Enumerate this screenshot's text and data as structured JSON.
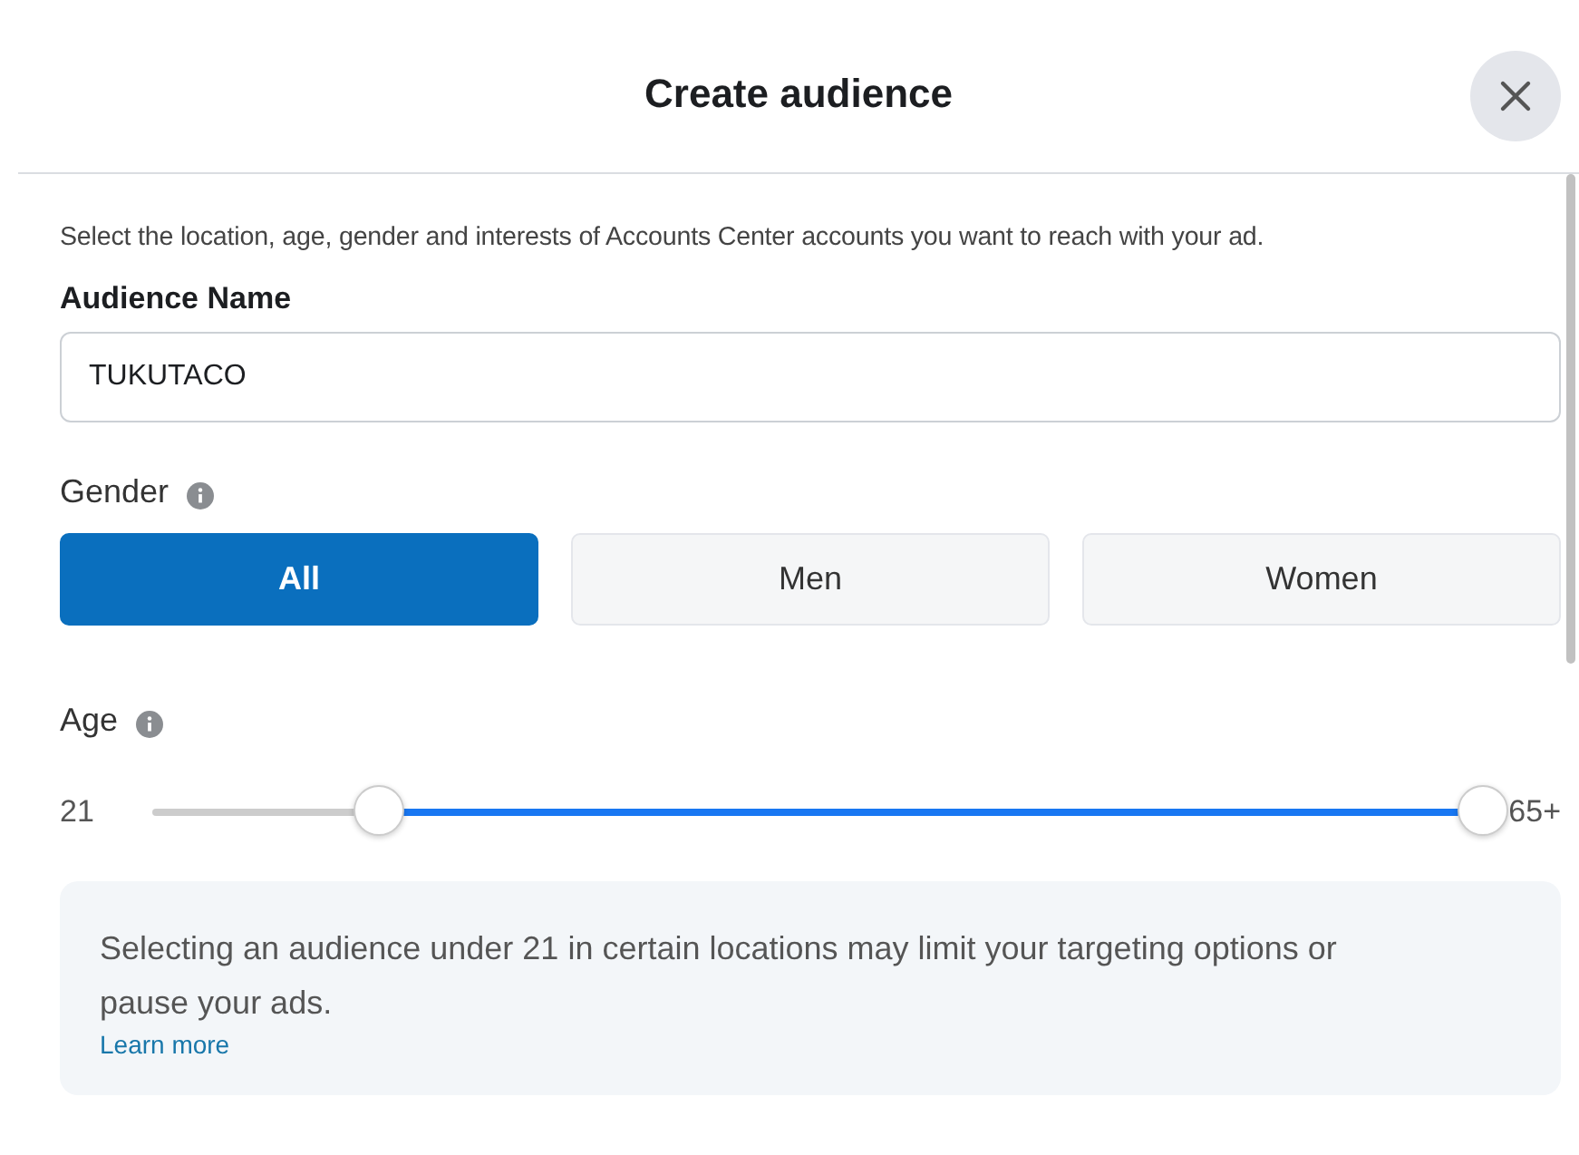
{
  "dialog": {
    "title": "Create audience"
  },
  "intro": "Select the location, age, gender and interests of Accounts Center accounts you want to reach with your ad.",
  "audience_name": {
    "label": "Audience Name",
    "value": "TUKUTACO"
  },
  "gender": {
    "label": "Gender",
    "options": [
      {
        "label": "All",
        "selected": true
      },
      {
        "label": "Men",
        "selected": false
      },
      {
        "label": "Women",
        "selected": false
      }
    ]
  },
  "age": {
    "label": "Age",
    "min_label": "21",
    "max_label": "65+",
    "thumbs": [
      {
        "level": 0.17
      },
      {
        "level": 1
      }
    ]
  },
  "notice": {
    "text": "Selecting an audience under 21 in certain locations may limit your targeting options or pause your ads.",
    "link": "Learn more"
  }
}
